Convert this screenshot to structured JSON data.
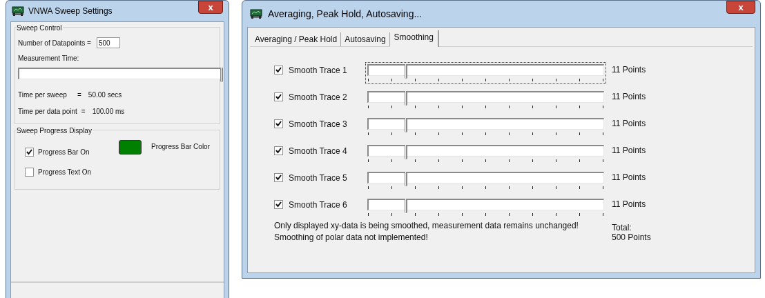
{
  "sweep_window": {
    "title": "VNWA Sweep Settings",
    "close": "x",
    "sweep_control": {
      "label": "Sweep Control",
      "datapoints_label": "Number of Datapoints =",
      "datapoints_value": "500",
      "measurement": {
        "label": "Measurement Time:",
        "level": 1
      },
      "times": [
        {
          "label": "Time per sweep",
          "eq": "=",
          "value": "50.00 secs"
        },
        {
          "label": "Time per data point",
          "eq": "=",
          "value": "100.00 ms"
        }
      ]
    },
    "progress_display": {
      "label": "Sweep Progress Display",
      "checkboxes": [
        {
          "label": "Progress Bar On",
          "checked": true
        },
        {
          "label": "Progress Text On",
          "checked": false
        }
      ],
      "swatch": {
        "color": "#008000"
      },
      "bar_color_label": "Progress Bar Color"
    }
  },
  "averaging_window": {
    "title": "Averaging, Peak Hold, Autosaving...",
    "close": "x",
    "tabs": [
      {
        "label": "Averaging / Peak Hold",
        "selected": false
      },
      {
        "label": "Autosaving",
        "selected": false
      },
      {
        "label": "Smoothing",
        "selected": true
      }
    ],
    "traces": [
      {
        "label": "Smooth Trace 1",
        "checked": true,
        "level": 0.16,
        "reading": "11 Points",
        "focused": true
      },
      {
        "label": "Smooth Trace 2",
        "checked": true,
        "level": 0.16,
        "reading": "11 Points",
        "focused": false
      },
      {
        "label": "Smooth Trace 3",
        "checked": true,
        "level": 0.16,
        "reading": "11 Points",
        "focused": false
      },
      {
        "label": "Smooth Trace 4",
        "checked": true,
        "level": 0.16,
        "reading": "11 Points",
        "focused": false
      },
      {
        "label": "Smooth Trace 5",
        "checked": true,
        "level": 0.16,
        "reading": "11 Points",
        "focused": false
      },
      {
        "label": "Smooth Trace 6",
        "checked": true,
        "level": 0.16,
        "reading": "11 Points",
        "focused": false
      }
    ],
    "notes": [
      "Only displayed xy-data is being smoothed, measurement data remains unchanged!",
      "Smoothing of polar data not implemented!"
    ],
    "total_label": "Total:",
    "total_value": "500 Points"
  }
}
